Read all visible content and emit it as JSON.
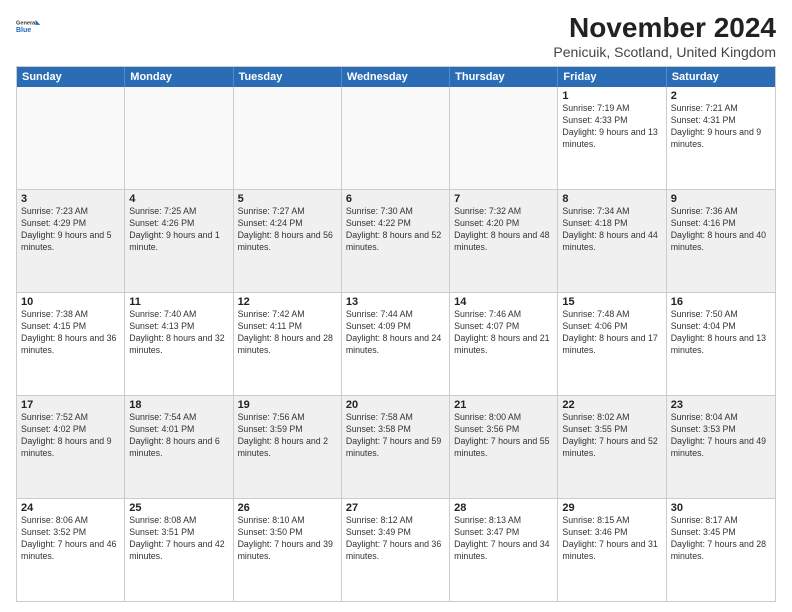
{
  "logo": {
    "general": "General",
    "blue": "Blue"
  },
  "header": {
    "title": "November 2024",
    "subtitle": "Penicuik, Scotland, United Kingdom"
  },
  "weekdays": [
    "Sunday",
    "Monday",
    "Tuesday",
    "Wednesday",
    "Thursday",
    "Friday",
    "Saturday"
  ],
  "rows": [
    [
      {
        "day": "",
        "info": ""
      },
      {
        "day": "",
        "info": ""
      },
      {
        "day": "",
        "info": ""
      },
      {
        "day": "",
        "info": ""
      },
      {
        "day": "",
        "info": ""
      },
      {
        "day": "1",
        "info": "Sunrise: 7:19 AM\nSunset: 4:33 PM\nDaylight: 9 hours and 13 minutes."
      },
      {
        "day": "2",
        "info": "Sunrise: 7:21 AM\nSunset: 4:31 PM\nDaylight: 9 hours and 9 minutes."
      }
    ],
    [
      {
        "day": "3",
        "info": "Sunrise: 7:23 AM\nSunset: 4:29 PM\nDaylight: 9 hours and 5 minutes."
      },
      {
        "day": "4",
        "info": "Sunrise: 7:25 AM\nSunset: 4:26 PM\nDaylight: 9 hours and 1 minute."
      },
      {
        "day": "5",
        "info": "Sunrise: 7:27 AM\nSunset: 4:24 PM\nDaylight: 8 hours and 56 minutes."
      },
      {
        "day": "6",
        "info": "Sunrise: 7:30 AM\nSunset: 4:22 PM\nDaylight: 8 hours and 52 minutes."
      },
      {
        "day": "7",
        "info": "Sunrise: 7:32 AM\nSunset: 4:20 PM\nDaylight: 8 hours and 48 minutes."
      },
      {
        "day": "8",
        "info": "Sunrise: 7:34 AM\nSunset: 4:18 PM\nDaylight: 8 hours and 44 minutes."
      },
      {
        "day": "9",
        "info": "Sunrise: 7:36 AM\nSunset: 4:16 PM\nDaylight: 8 hours and 40 minutes."
      }
    ],
    [
      {
        "day": "10",
        "info": "Sunrise: 7:38 AM\nSunset: 4:15 PM\nDaylight: 8 hours and 36 minutes."
      },
      {
        "day": "11",
        "info": "Sunrise: 7:40 AM\nSunset: 4:13 PM\nDaylight: 8 hours and 32 minutes."
      },
      {
        "day": "12",
        "info": "Sunrise: 7:42 AM\nSunset: 4:11 PM\nDaylight: 8 hours and 28 minutes."
      },
      {
        "day": "13",
        "info": "Sunrise: 7:44 AM\nSunset: 4:09 PM\nDaylight: 8 hours and 24 minutes."
      },
      {
        "day": "14",
        "info": "Sunrise: 7:46 AM\nSunset: 4:07 PM\nDaylight: 8 hours and 21 minutes."
      },
      {
        "day": "15",
        "info": "Sunrise: 7:48 AM\nSunset: 4:06 PM\nDaylight: 8 hours and 17 minutes."
      },
      {
        "day": "16",
        "info": "Sunrise: 7:50 AM\nSunset: 4:04 PM\nDaylight: 8 hours and 13 minutes."
      }
    ],
    [
      {
        "day": "17",
        "info": "Sunrise: 7:52 AM\nSunset: 4:02 PM\nDaylight: 8 hours and 9 minutes."
      },
      {
        "day": "18",
        "info": "Sunrise: 7:54 AM\nSunset: 4:01 PM\nDaylight: 8 hours and 6 minutes."
      },
      {
        "day": "19",
        "info": "Sunrise: 7:56 AM\nSunset: 3:59 PM\nDaylight: 8 hours and 2 minutes."
      },
      {
        "day": "20",
        "info": "Sunrise: 7:58 AM\nSunset: 3:58 PM\nDaylight: 7 hours and 59 minutes."
      },
      {
        "day": "21",
        "info": "Sunrise: 8:00 AM\nSunset: 3:56 PM\nDaylight: 7 hours and 55 minutes."
      },
      {
        "day": "22",
        "info": "Sunrise: 8:02 AM\nSunset: 3:55 PM\nDaylight: 7 hours and 52 minutes."
      },
      {
        "day": "23",
        "info": "Sunrise: 8:04 AM\nSunset: 3:53 PM\nDaylight: 7 hours and 49 minutes."
      }
    ],
    [
      {
        "day": "24",
        "info": "Sunrise: 8:06 AM\nSunset: 3:52 PM\nDaylight: 7 hours and 46 minutes."
      },
      {
        "day": "25",
        "info": "Sunrise: 8:08 AM\nSunset: 3:51 PM\nDaylight: 7 hours and 42 minutes."
      },
      {
        "day": "26",
        "info": "Sunrise: 8:10 AM\nSunset: 3:50 PM\nDaylight: 7 hours and 39 minutes."
      },
      {
        "day": "27",
        "info": "Sunrise: 8:12 AM\nSunset: 3:49 PM\nDaylight: 7 hours and 36 minutes."
      },
      {
        "day": "28",
        "info": "Sunrise: 8:13 AM\nSunset: 3:47 PM\nDaylight: 7 hours and 34 minutes."
      },
      {
        "day": "29",
        "info": "Sunrise: 8:15 AM\nSunset: 3:46 PM\nDaylight: 7 hours and 31 minutes."
      },
      {
        "day": "30",
        "info": "Sunrise: 8:17 AM\nSunset: 3:45 PM\nDaylight: 7 hours and 28 minutes."
      }
    ]
  ]
}
